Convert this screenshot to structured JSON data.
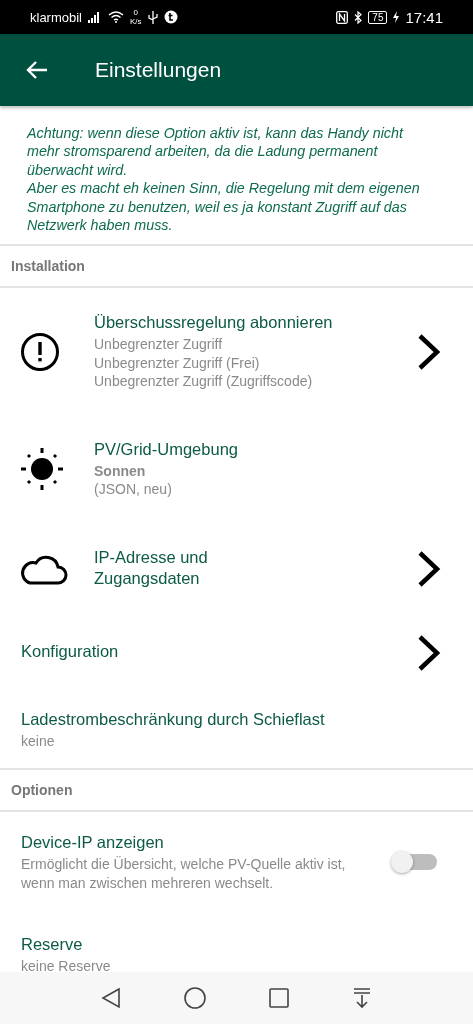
{
  "status_bar": {
    "carrier": "klarmobil",
    "speed_value": "0",
    "speed_unit": "K/s",
    "battery": "75",
    "time": "17:41"
  },
  "app_bar": {
    "title": "Einstellungen"
  },
  "warning": "Achtung: wenn diese Option aktiv ist, kann das Handy nicht mehr stromsparend arbeiten, da die Ladung permanent überwacht wird.\nAber es macht eh keinen Sinn, die Regelung mit dem eigenen Smartphone zu benutzen, weil es ja konstant Zugriff auf das Netzwerk haben muss.",
  "sections": [
    {
      "title": "Installation",
      "items": [
        {
          "kind": "link",
          "title": "Überschussregelung abonnieren",
          "chevron": true,
          "lines": [
            {
              "text": "Unbegrenzter Zugriff"
            },
            {
              "text": "Unbegrenzter Zugriff (Frei)"
            },
            {
              "text": "Unbegrenzter Zugriff (Zugriffscode)"
            }
          ]
        },
        {
          "kind": "link",
          "title": "PV/Grid-Umgebung",
          "lines": [
            {
              "text": "Sonnen",
              "bold": true
            },
            {
              "text": "(JSON, neu)"
            }
          ]
        },
        {
          "kind": "link",
          "title": "IP-Adresse und\nZugangsdaten",
          "chevron": true
        },
        {
          "kind": "link",
          "title": "Konfiguration",
          "chevron": true
        },
        {
          "kind": "link",
          "title": "Ladestrombeschränkung durch Schieflast",
          "lines": [
            {
              "text": "keine"
            }
          ]
        }
      ]
    },
    {
      "title": "Optionen",
      "items": [
        {
          "kind": "toggle",
          "title": "Device-IP anzeigen",
          "on": false,
          "lines": [
            {
              "text": "Ermöglicht die Übersicht, welche PV-Quelle aktiv ist, wenn man zwischen mehreren wechselt."
            }
          ]
        },
        {
          "kind": "link",
          "title": "Reserve",
          "lines": [
            {
              "text": "keine Reserve"
            }
          ]
        }
      ]
    }
  ]
}
